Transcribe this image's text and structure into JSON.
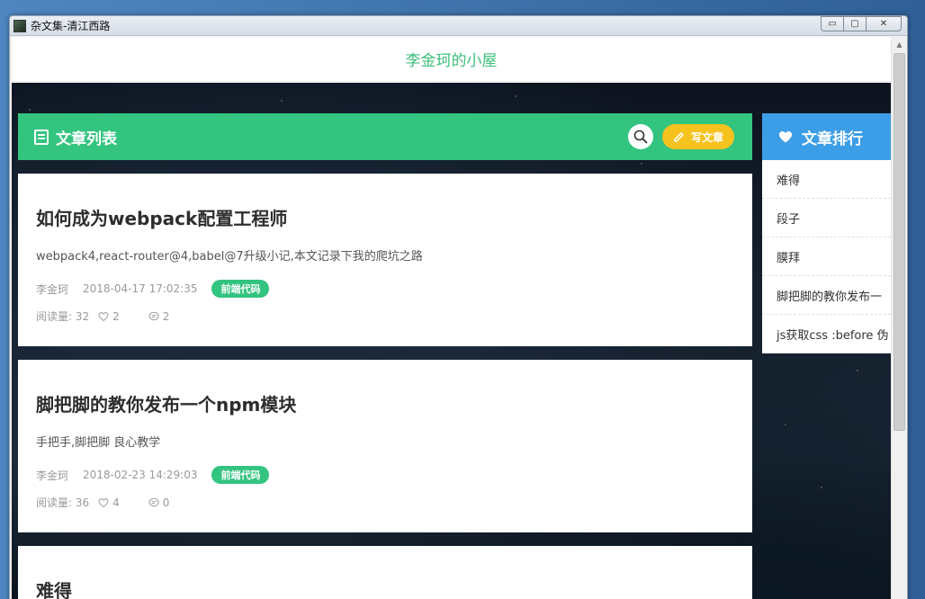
{
  "window": {
    "title": "杂文集-清江西路",
    "controls": {
      "minimize": "▭",
      "maximize": "▢",
      "close": "✕"
    }
  },
  "site": {
    "title": "李金珂的小屋"
  },
  "article_list": {
    "title": "文章列表",
    "write_label": "写文章",
    "articles": [
      {
        "title": "如何成为webpack配置工程师",
        "summary": "webpack4,react-router@4,babel@7升级小记,本文记录下我的爬坑之路",
        "author": "李金珂",
        "date": "2018-04-17 17:02:35",
        "tag": "前端代码",
        "reads_label": "阅读量: 32",
        "likes": "2",
        "comments": "2"
      },
      {
        "title": "脚把脚的教你发布一个npm模块",
        "summary": "手把手,脚把脚 良心教学",
        "author": "李金珂",
        "date": "2018-02-23 14:29:03",
        "tag": "前端代码",
        "reads_label": "阅读量: 36",
        "likes": "4",
        "comments": "0"
      },
      {
        "title": "难得"
      }
    ]
  },
  "ranking": {
    "title": "文章排行",
    "items": [
      "难得",
      "段子",
      "膜拜",
      "脚把脚的教你发布一",
      "js获取css :before 伪"
    ]
  },
  "colors": {
    "site_title": "#3cbf7b",
    "list_header": "#33c47f",
    "tag": "#33c47f",
    "write_button": "#f6c21d",
    "ranking_header": "#3c9ee6"
  },
  "icons": {
    "list_header": "document-icon",
    "search": "search-icon",
    "write": "pencil-icon",
    "ranking_header": "heart-icon",
    "likes": "heart-outline-icon",
    "comments": "comment-icon"
  }
}
